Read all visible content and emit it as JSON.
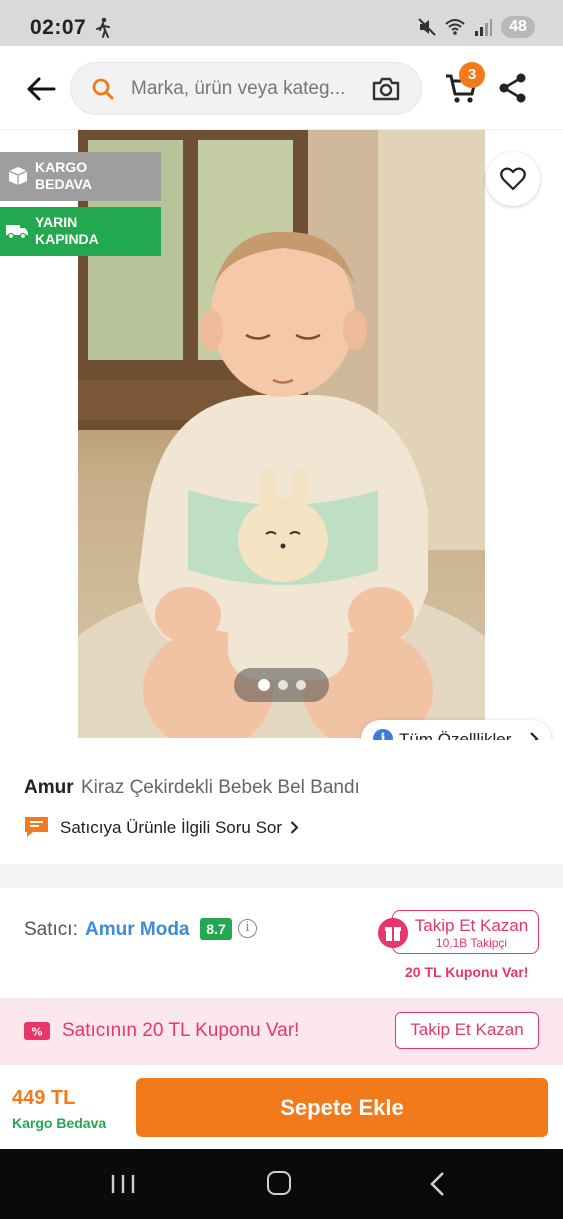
{
  "status_bar": {
    "time": "02:07",
    "battery": "48",
    "icons": [
      "walking-icon",
      "mute-icon",
      "wifi-icon",
      "signal-icon",
      "battery-icon"
    ]
  },
  "header": {
    "search_placeholder": "Marka, ürün veya kateg...",
    "cart_count": "3",
    "icons": [
      "back-arrow-icon",
      "search-icon",
      "camera-icon",
      "cart-icon",
      "share-icon"
    ]
  },
  "gallery": {
    "badges": [
      {
        "line1": "KARGO",
        "line2": "BEDAVA",
        "color": "#9e9e9e",
        "icon": "box-icon"
      },
      {
        "line1": "YARIN",
        "line2": "KAPINDA",
        "color": "#22a94f",
        "icon": "truck-icon"
      }
    ],
    "image_dots": 3,
    "active_dot": 0,
    "all_features_label": "Tüm Özelllikler"
  },
  "product": {
    "brand": "Amur",
    "name": "Kiraz Çekirdekli Bebek Bel Bandı",
    "ask_seller_label": "Satıcıya Ürünle İlgili Soru Sor"
  },
  "seller": {
    "label": "Satıcı:",
    "name": "Amur Moda",
    "score": "8.7",
    "follow_title": "Takip Et Kazan",
    "follow_sub": "10,1B Takipçi",
    "coupon_note": "20 TL Kuponu Var!"
  },
  "coupon_banner": {
    "text": "Satıcının 20 TL Kuponu Var!",
    "button_label": "Takip Et Kazan"
  },
  "bottom_bar": {
    "price": "449 TL",
    "shipping": "Kargo Bedava",
    "add_to_cart": "Sepete Ekle"
  },
  "colors": {
    "accent_orange": "#f27a1a",
    "green": "#22a94f",
    "pink": "#e8366c",
    "link_blue": "#3d8bd9"
  }
}
